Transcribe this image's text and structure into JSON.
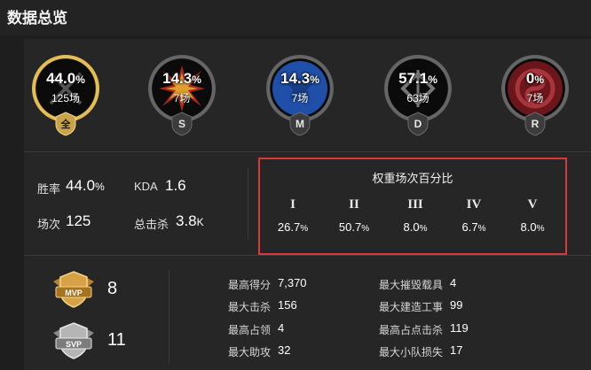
{
  "page": {
    "title": "数据总览"
  },
  "modes": [
    {
      "rate_num": "44.0",
      "unit": "%",
      "count": "125场",
      "badge": "全",
      "ring": "#e8c25a"
    },
    {
      "rate_num": "14.3",
      "unit": "%",
      "count": "7场",
      "badge": "S",
      "ring": "#555555"
    },
    {
      "rate_num": "14.3",
      "unit": "%",
      "count": "7场",
      "badge": "M",
      "ring": "#555555"
    },
    {
      "rate_num": "57.1",
      "unit": "%",
      "count": "63场",
      "badge": "D",
      "ring": "#555555"
    },
    {
      "rate_num": "0",
      "unit": "%",
      "count": "7场",
      "badge": "R",
      "ring": "#555555"
    }
  ],
  "summary": {
    "winrate_label": "胜率",
    "winrate_num": "44.0",
    "winrate_unit": "%",
    "kda_label": "KDA",
    "kda_value": "1.6",
    "matches_label": "场次",
    "matches_value": "125",
    "kills_label": "总击杀",
    "kills_num": "3.8",
    "kills_unit": "K"
  },
  "weights": {
    "title": "权重场次百分比",
    "columns": [
      {
        "label": "I",
        "value": "26.7",
        "unit": "%"
      },
      {
        "label": "II",
        "value": "50.7",
        "unit": "%"
      },
      {
        "label": "III",
        "value": "8.0",
        "unit": "%"
      },
      {
        "label": "IV",
        "value": "6.7",
        "unit": "%"
      },
      {
        "label": "V",
        "value": "8.0",
        "unit": "%"
      }
    ]
  },
  "medals": {
    "mvp": {
      "label": "MVP",
      "count": "8"
    },
    "svp": {
      "label": "SVP",
      "count": "11"
    }
  },
  "records": {
    "left": [
      {
        "label": "最高得分",
        "value": "7,370"
      },
      {
        "label": "最大击杀",
        "value": "156"
      },
      {
        "label": "最高占领",
        "value": "4"
      },
      {
        "label": "最大助攻",
        "value": "32"
      }
    ],
    "right": [
      {
        "label": "最大摧毁载具",
        "value": "4"
      },
      {
        "label": "最大建造工事",
        "value": "99"
      },
      {
        "label": "最高占点击杀",
        "value": "119"
      },
      {
        "label": "最大小队损失",
        "value": "17"
      }
    ]
  },
  "colors": {
    "highlight": "#d93a36",
    "gold": "#e8c25a",
    "conquest_blue": "#1f4fa8",
    "rush_red": "#8a1c22"
  }
}
